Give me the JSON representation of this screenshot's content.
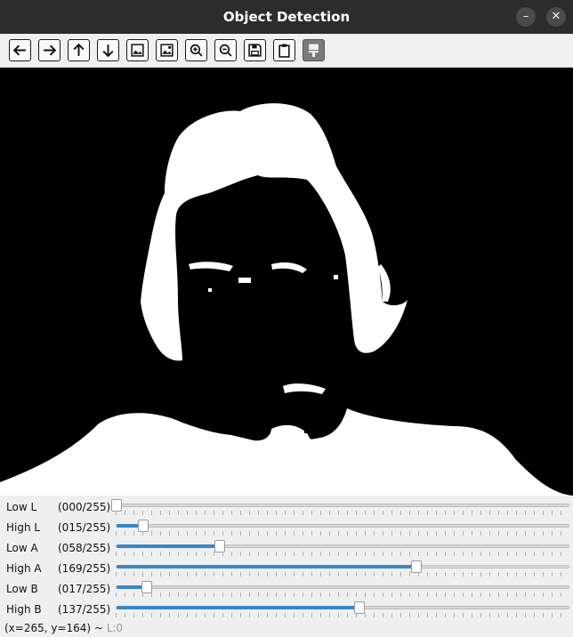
{
  "window": {
    "title": "Object Detection",
    "minimize_glyph": "–",
    "close_glyph": "✕"
  },
  "toolbar": {
    "buttons": [
      {
        "name": "arrow-left-icon"
      },
      {
        "name": "arrow-right-icon"
      },
      {
        "name": "arrow-up-icon"
      },
      {
        "name": "arrow-down-icon"
      },
      {
        "name": "image-icon"
      },
      {
        "name": "image-settings-icon"
      },
      {
        "name": "zoom-in-icon"
      },
      {
        "name": "zoom-out-icon"
      },
      {
        "name": "save-icon"
      },
      {
        "name": "clipboard-icon"
      },
      {
        "name": "brush-icon"
      }
    ]
  },
  "sliders": [
    {
      "label": "Low L",
      "value_text": "(000/255)",
      "value": 0,
      "max": 255
    },
    {
      "label": "High L",
      "value_text": "(015/255)",
      "value": 15,
      "max": 255
    },
    {
      "label": "Low A",
      "value_text": "(058/255)",
      "value": 58,
      "max": 255
    },
    {
      "label": "High A",
      "value_text": "(169/255)",
      "value": 169,
      "max": 255
    },
    {
      "label": "Low B",
      "value_text": "(017/255)",
      "value": 17,
      "max": 255
    },
    {
      "label": "High B",
      "value_text": "(137/255)",
      "value": 137,
      "max": 255
    }
  ],
  "status": {
    "coords": "(x=265, y=164) ~",
    "channel": "L:0"
  },
  "colors": {
    "accent": "#3b86c8",
    "mask_foreground": "#ffffff",
    "mask_background": "#000000"
  }
}
